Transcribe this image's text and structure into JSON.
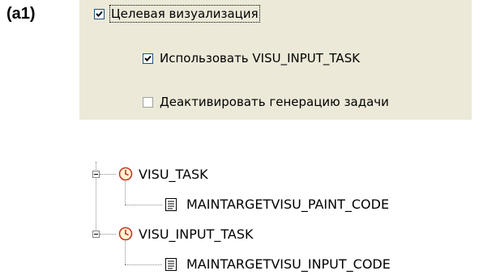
{
  "figure_label": "(a1)",
  "options": {
    "target_visualization": {
      "label": "Целевая визуализация",
      "checked": true
    },
    "use_visu_input_task": {
      "label": "Использовать VISU_INPUT_TASK",
      "checked": true
    },
    "deactivate_task_generation": {
      "label": "Деактивировать генерацию задачи",
      "checked": false
    }
  },
  "task_tree": {
    "tasks": [
      {
        "name": "VISU_TASK",
        "call": "MAINTARGETVISU_PAINT_CODE"
      },
      {
        "name": "VISU_INPUT_TASK",
        "call": "MAINTARGETVISU_INPUT_CODE"
      }
    ]
  },
  "icons": {
    "task": "clock-icon",
    "call": "program-call-icon"
  },
  "colors": {
    "panel_background": "#ece9d8",
    "checkbox_border": "#1c5180",
    "task_icon_red": "#c0392b",
    "task_icon_yellow": "#e8c23a"
  }
}
